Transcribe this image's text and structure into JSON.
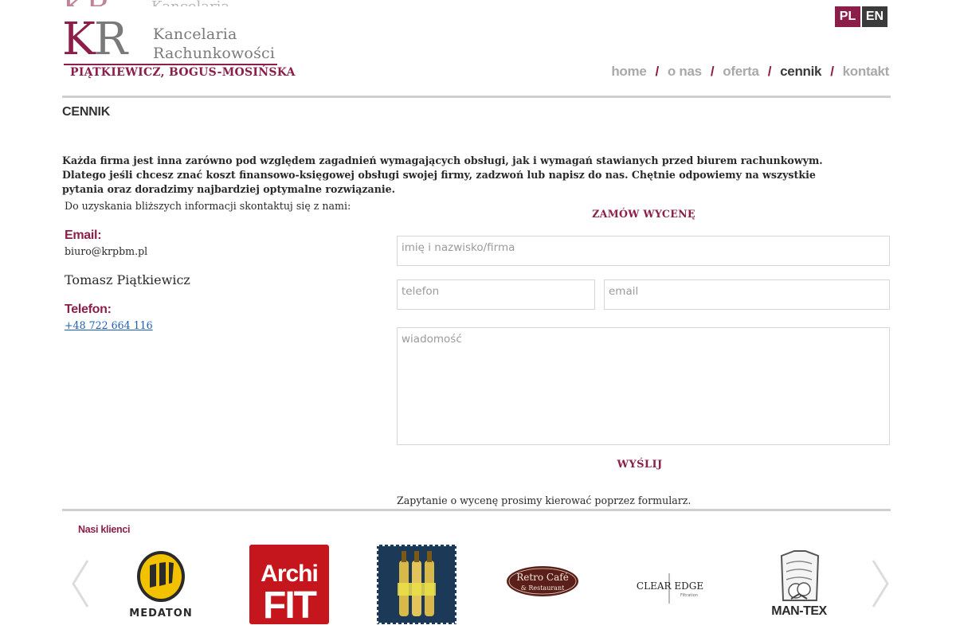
{
  "brand": {
    "line1": "Kancelaria",
    "line2": "Rachunkowości",
    "line3": "PIĄTKIEWICZ, BOGUS-MOSIŃSKA",
    "ghost_text": "Kancelaria"
  },
  "lang": {
    "pl": "PL",
    "en": "EN",
    "active": "PL"
  },
  "nav": {
    "items": [
      {
        "label": "home",
        "active": false
      },
      {
        "label": "o nas",
        "active": false
      },
      {
        "label": "oferta",
        "active": false
      },
      {
        "label": "cennik",
        "active": true
      },
      {
        "label": "kontakt",
        "active": false
      }
    ],
    "separator": "/"
  },
  "page": {
    "title": "CENNIK",
    "intro": "Każda firma jest inna zarówno pod względem zagadnień wymagających obsługi,  jak i wymagań stawianych przed biurem rachunkowym. Dlatego jeśli chcesz znać koszt finansowo-księgowej obsługi swojej firmy, zadzwoń lub napisz do nas. Chętnie odpowiemy na wszystkie pytania oraz doradzimy najbardziej optymalne rozwiązanie."
  },
  "contact": {
    "lead": "Do uzyskania bliższych informacji skontaktuj się z nami:",
    "email_label": "Email:",
    "email": "biuro@krpbm.pl",
    "person": "Tomasz Piątkiewicz",
    "phone_label": "Telefon:",
    "phone": "+48 722 664 116"
  },
  "form": {
    "title": "ZAMÓW WYCENĘ",
    "name_placeholder": "imię i nazwisko/firma",
    "phone_placeholder": "telefon",
    "email_placeholder": "email",
    "message_placeholder": "wiadomość",
    "send_label": "WYŚLIJ",
    "note": "Zapytanie o wycenę prosimy kierować poprzez formularz."
  },
  "clients": {
    "title": "Nasi klienci",
    "logos": [
      {
        "name": "medaton",
        "text": "MEDATON"
      },
      {
        "name": "archifit",
        "text1": "Archi",
        "text2": "FIT"
      },
      {
        "name": "beer-bottles"
      },
      {
        "name": "retro-cafe",
        "text1": "Retro Café",
        "text2": "& Restaurant"
      },
      {
        "name": "clearedge",
        "text1": "CLEAR EDGE",
        "text2": "Filtration"
      },
      {
        "name": "man-tex",
        "text": "MAN-TEX"
      }
    ]
  },
  "colors": {
    "brand_maroon": "#8c1f49",
    "nav_gray": "#a9a9a9",
    "active_gray": "#3a3a3a",
    "lang_en_bg": "#3b3b3b"
  },
  "icons": {
    "prev": "chevron-left-icon",
    "next": "chevron-right-icon"
  }
}
